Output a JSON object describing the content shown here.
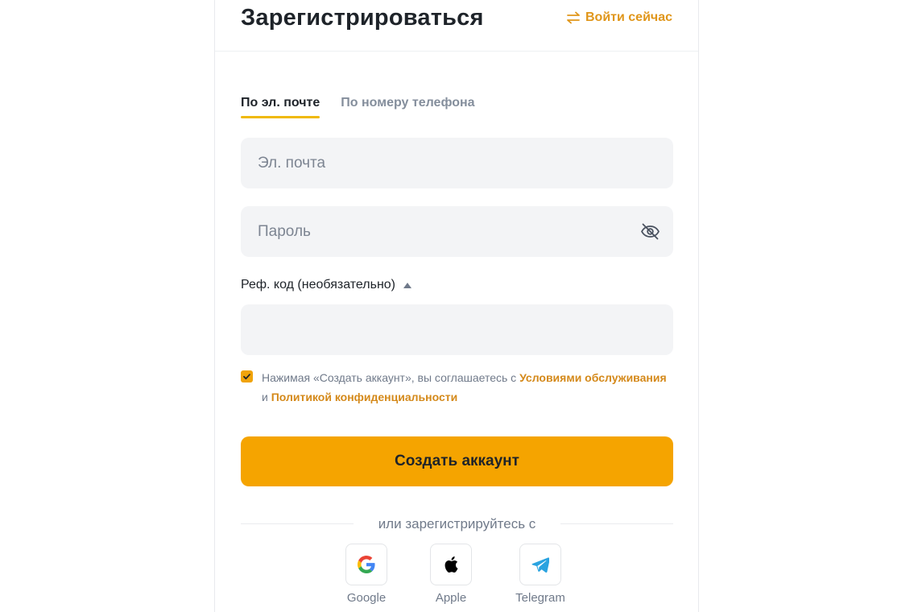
{
  "header": {
    "title": "Зарегистрироваться",
    "login_link": "Войти сейчас"
  },
  "tabs": [
    {
      "label": "По эл. почте",
      "active": true
    },
    {
      "label": "По номеру телефона",
      "active": false
    }
  ],
  "form": {
    "email": {
      "value": "",
      "placeholder": "Эл. почта"
    },
    "password": {
      "value": "",
      "placeholder": "Пароль"
    },
    "referral": {
      "label": "Реф. код (необязательно)",
      "value": "",
      "expanded": true
    }
  },
  "agreement": {
    "checked": true,
    "text_before": "Нажимая «Создать аккаунт», вы соглашаетесь с ",
    "terms_link": "Условиями обслуживания",
    "text_middle": " и ",
    "privacy_link": "Политикой конфиденциальности"
  },
  "submit_label": "Создать аккаунт",
  "divider_text": "или зарегистрируйтесь с",
  "social": [
    {
      "label": "Google",
      "icon": "google-icon"
    },
    {
      "label": "Apple",
      "icon": "apple-icon"
    },
    {
      "label": "Telegram",
      "icon": "telegram-icon"
    }
  ],
  "colors": {
    "accent": "#f5a400",
    "link": "#d4891a",
    "field_bg": "#f3f4f6",
    "muted_text": "#707a8a"
  }
}
